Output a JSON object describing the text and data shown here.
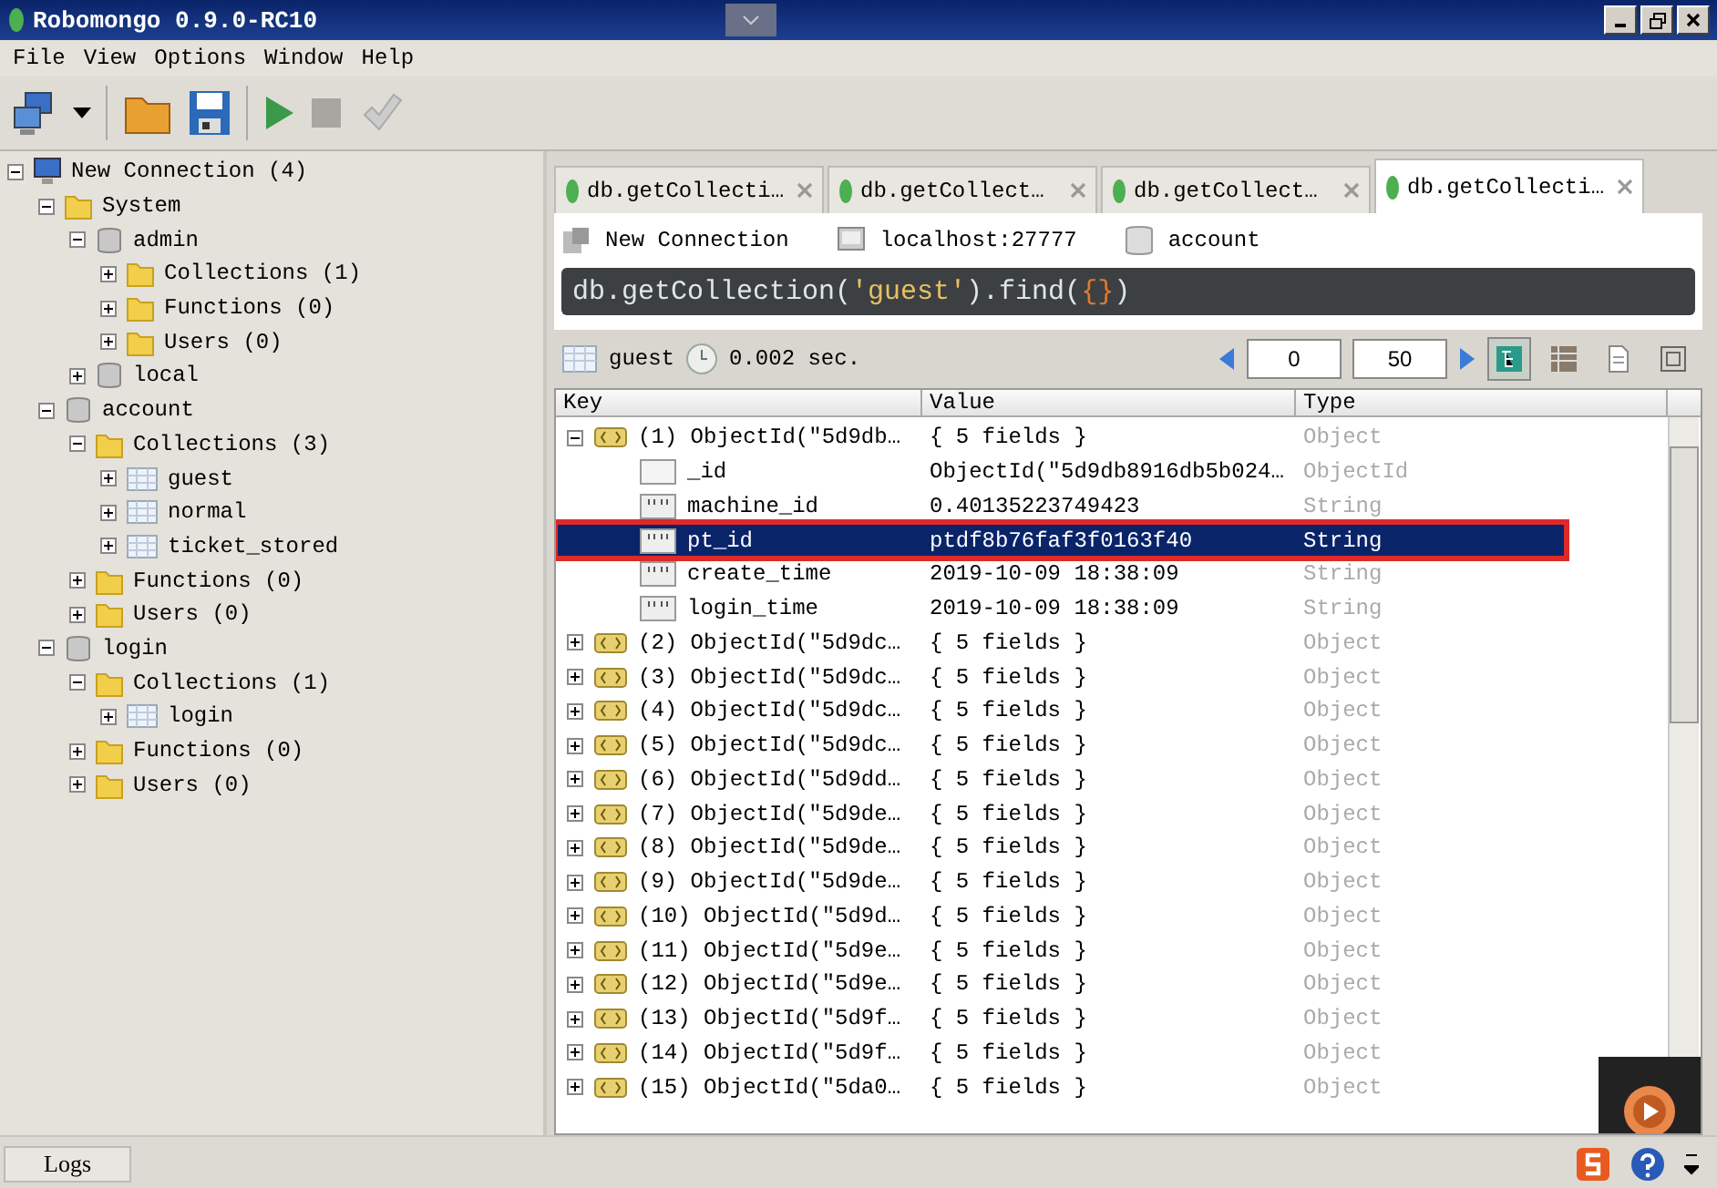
{
  "window": {
    "title": "Robomongo 0.9.0-RC10"
  },
  "menu": [
    "File",
    "View",
    "Options",
    "Window",
    "Help"
  ],
  "tree": [
    {
      "kind": "connection",
      "label": "New Connection (4)",
      "expanded": true,
      "children": [
        {
          "kind": "folder",
          "label": "System",
          "expanded": true,
          "children": [
            {
              "kind": "database",
              "label": "admin",
              "expanded": true,
              "children": [
                {
                  "kind": "folder",
                  "label": "Collections (1)",
                  "expanded": false
                },
                {
                  "kind": "folder",
                  "label": "Functions (0)",
                  "expanded": false
                },
                {
                  "kind": "folder",
                  "label": "Users (0)",
                  "expanded": false
                }
              ]
            },
            {
              "kind": "database",
              "label": "local",
              "expanded": false
            }
          ]
        },
        {
          "kind": "database",
          "label": "account",
          "expanded": true,
          "children": [
            {
              "kind": "folder",
              "label": "Collections (3)",
              "expanded": true,
              "children": [
                {
                  "kind": "collection",
                  "label": "guest",
                  "expanded": false
                },
                {
                  "kind": "collection",
                  "label": "normal",
                  "expanded": false
                },
                {
                  "kind": "collection",
                  "label": "ticket_stored",
                  "expanded": false
                }
              ]
            },
            {
              "kind": "folder",
              "label": "Functions (0)",
              "expanded": false
            },
            {
              "kind": "folder",
              "label": "Users (0)",
              "expanded": false
            }
          ]
        },
        {
          "kind": "database",
          "label": "login",
          "expanded": true,
          "children": [
            {
              "kind": "folder",
              "label": "Collections (1)",
              "expanded": true,
              "children": [
                {
                  "kind": "collection",
                  "label": "login",
                  "expanded": false
                }
              ]
            },
            {
              "kind": "folder",
              "label": "Functions (0)",
              "expanded": false
            },
            {
              "kind": "folder",
              "label": "Users (0)",
              "expanded": false
            }
          ]
        }
      ]
    }
  ],
  "tabs": [
    {
      "label": "db.getCollecti…",
      "selected": false
    },
    {
      "label": "db.getCollect…",
      "selected": false
    },
    {
      "label": "db.getCollect…",
      "selected": false
    },
    {
      "label": "db.getCollecti…",
      "selected": true
    }
  ],
  "query_info": {
    "connection": "New Connection",
    "host": "localhost:27777",
    "database": "account"
  },
  "query": [
    {
      "kind": "plain",
      "text": "db.getCollection("
    },
    {
      "kind": "string",
      "text": "'guest'"
    },
    {
      "kind": "plain",
      "text": ").find("
    },
    {
      "kind": "brace",
      "text": "{}"
    },
    {
      "kind": "plain",
      "text": ")"
    }
  ],
  "result_bar": {
    "collection": "guest",
    "time": "0.002 sec.",
    "skip": "0",
    "limit": "50",
    "views": [
      {
        "kind": "tree",
        "selected": true
      },
      {
        "kind": "table",
        "selected": false
      },
      {
        "kind": "text",
        "selected": false
      }
    ]
  },
  "table": {
    "columns": [
      "Key",
      "Value",
      "Type"
    ],
    "rows": [
      {
        "kind": "object",
        "key": "(1) ObjectId(\"5d9db…",
        "value": "{ 5 fields }",
        "type": "Object",
        "expanded": true,
        "children": [
          {
            "kind": "id",
            "key": "_id",
            "value": "ObjectId(\"5d9db8916db5b024…",
            "type": "ObjectId",
            "selected": false,
            "highlighted": false
          },
          {
            "kind": "string",
            "key": "machine_id",
            "value": "0.40135223749423",
            "type": "String",
            "selected": false,
            "highlighted": false
          },
          {
            "kind": "string",
            "key": "pt_id",
            "value": "ptdf8b76faf3f0163f40",
            "type": "String",
            "selected": true,
            "highlighted": true
          },
          {
            "kind": "string",
            "key": "create_time",
            "value": "2019-10-09 18:38:09",
            "type": "String",
            "selected": false,
            "highlighted": false
          },
          {
            "kind": "string",
            "key": "login_time",
            "value": "2019-10-09 18:38:09",
            "type": "String",
            "selected": false,
            "highlighted": false
          }
        ]
      },
      {
        "kind": "object",
        "key": "(2) ObjectId(\"5d9dc…",
        "value": "{ 5 fields }",
        "type": "Object",
        "expanded": false
      },
      {
        "kind": "object",
        "key": "(3) ObjectId(\"5d9dc…",
        "value": "{ 5 fields }",
        "type": "Object",
        "expanded": false
      },
      {
        "kind": "object",
        "key": "(4) ObjectId(\"5d9dc…",
        "value": "{ 5 fields }",
        "type": "Object",
        "expanded": false
      },
      {
        "kind": "object",
        "key": "(5) ObjectId(\"5d9dc…",
        "value": "{ 5 fields }",
        "type": "Object",
        "expanded": false
      },
      {
        "kind": "object",
        "key": "(6) ObjectId(\"5d9dd…",
        "value": "{ 5 fields }",
        "type": "Object",
        "expanded": false
      },
      {
        "kind": "object",
        "key": "(7) ObjectId(\"5d9de…",
        "value": "{ 5 fields }",
        "type": "Object",
        "expanded": false
      },
      {
        "kind": "object",
        "key": "(8) ObjectId(\"5d9de…",
        "value": "{ 5 fields }",
        "type": "Object",
        "expanded": false
      },
      {
        "kind": "object",
        "key": "(9) ObjectId(\"5d9de…",
        "value": "{ 5 fields }",
        "type": "Object",
        "expanded": false
      },
      {
        "kind": "object",
        "key": "(10) ObjectId(\"5d9d…",
        "value": "{ 5 fields }",
        "type": "Object",
        "expanded": false
      },
      {
        "kind": "object",
        "key": "(11) ObjectId(\"5d9e…",
        "value": "{ 5 fields }",
        "type": "Object",
        "expanded": false
      },
      {
        "kind": "object",
        "key": "(12) ObjectId(\"5d9e…",
        "value": "{ 5 fields }",
        "type": "Object",
        "expanded": false
      },
      {
        "kind": "object",
        "key": "(13) ObjectId(\"5d9f…",
        "value": "{ 5 fields }",
        "type": "Object",
        "expanded": false
      },
      {
        "kind": "object",
        "key": "(14) ObjectId(\"5d9f…",
        "value": "{ 5 fields }",
        "type": "Object",
        "expanded": false
      },
      {
        "kind": "object",
        "key": "(15) ObjectId(\"5da0…",
        "value": "{ 5 fields }",
        "type": "Object",
        "expanded": false
      }
    ]
  },
  "bottom_tabs": [
    "Logs"
  ]
}
